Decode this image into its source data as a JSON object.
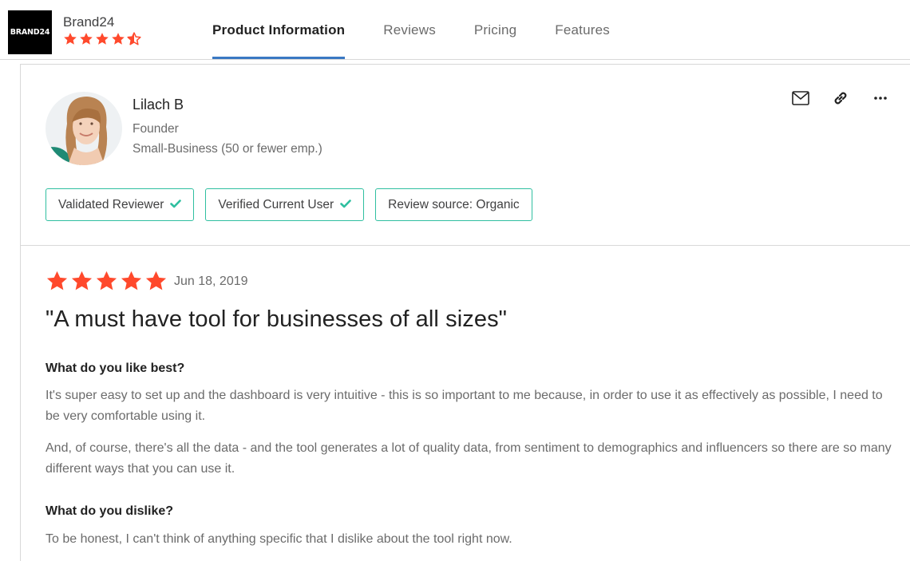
{
  "product": {
    "logo_text": "BRAND24",
    "name": "Brand24",
    "rating_stars": 4.5,
    "star_color": "#ff492c"
  },
  "nav": {
    "tabs": [
      {
        "label": "Product Information",
        "active": true
      },
      {
        "label": "Reviews",
        "active": false
      },
      {
        "label": "Pricing",
        "active": false
      },
      {
        "label": "Features",
        "active": false
      }
    ],
    "active_color": "#3a78c3"
  },
  "reviewer": {
    "name": "Lilach B",
    "title": "Founder",
    "segment": "Small-Business (50 or fewer emp.)"
  },
  "actions": [
    "mail-icon",
    "link-icon",
    "more-icon"
  ],
  "badges": [
    {
      "label": "Validated Reviewer",
      "check": true
    },
    {
      "label": "Verified Current User",
      "check": true
    },
    {
      "label": "Review source: Organic",
      "check": false
    }
  ],
  "badge_color": "#2fbfa0",
  "review": {
    "rating_stars": 5,
    "date": "Jun 18, 2019",
    "title": "\"A must have tool for businesses of all sizes\"",
    "like_heading": "What do you like best?",
    "like_p1": "It's super easy to set up and the dashboard is very intuitive - this is so important to me because, in order to use it as effectively as possible, I need to be very comfortable using it.",
    "like_p2": "And, of course, there's all the data - and the tool generates a lot of quality data, from sentiment to demographics and influencers so there are so many different ways that you can use it.",
    "dislike_heading": "What do you dislike?",
    "dislike_p1": "To be honest, I can't think of anything specific that I dislike about the tool right now."
  }
}
